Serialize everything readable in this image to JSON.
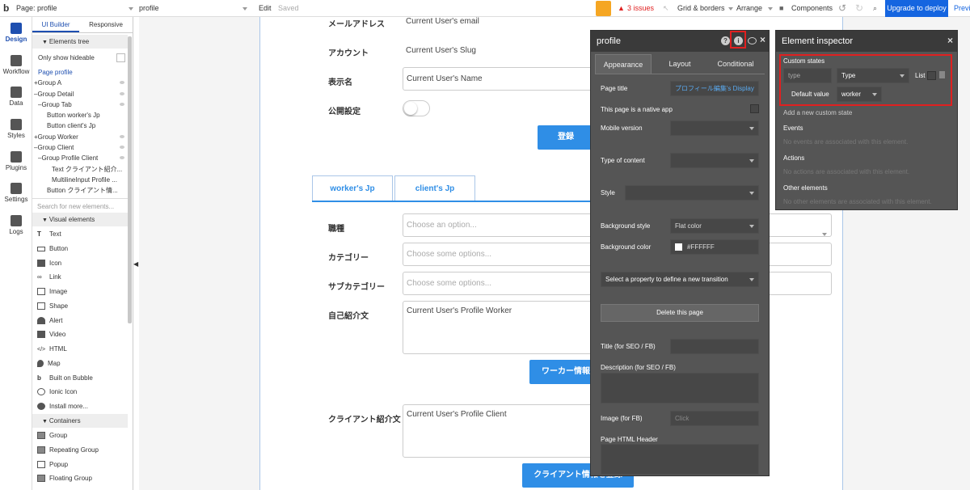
{
  "topbar": {
    "page_label": "Page: profile",
    "page_select": "profile",
    "edit": "Edit",
    "saved": "Saved",
    "issues": "3 issues",
    "grid": "Grid & borders",
    "arrange": "Arrange",
    "components": "Components",
    "upgrade": "Upgrade to deploy",
    "preview": "Previ"
  },
  "rail": [
    {
      "label": "Design",
      "icon": "design-icon"
    },
    {
      "label": "Workflow",
      "icon": "workflow-icon"
    },
    {
      "label": "Data",
      "icon": "data-icon"
    },
    {
      "label": "Styles",
      "icon": "styles-icon"
    },
    {
      "label": "Plugins",
      "icon": "plugins-icon"
    },
    {
      "label": "Settings",
      "icon": "settings-icon"
    },
    {
      "label": "Logs",
      "icon": "logs-icon"
    }
  ],
  "palette": {
    "tab_ui": "UI Builder",
    "tab_responsive": "Responsive",
    "elements_tree": "Elements tree",
    "only_hideable": "Only show hideable",
    "tree": [
      "Page profile",
      "Group A",
      "Group Detail",
      "Group Tab",
      "Button worker's Jp",
      "Button client's Jp",
      "Group Worker",
      "Group Client",
      "Group Profile Client",
      "Text クライアント紹介...",
      "MultilineInput Profile ...",
      "Button クライアント情..."
    ],
    "search_placeholder": "Search for new elements...",
    "visual_elements": "Visual elements",
    "visual": [
      "Text",
      "Button",
      "Icon",
      "Link",
      "Image",
      "Shape",
      "Alert",
      "Video",
      "HTML",
      "Map",
      "Built on Bubble",
      "Ionic Icon",
      "Install more..."
    ],
    "containers": "Containers",
    "container_items": [
      "Group",
      "Repeating Group",
      "Popup",
      "Floating Group"
    ]
  },
  "page": {
    "email_label": "メールアドレス",
    "email_value": "Current User's email",
    "account_label": "アカウント",
    "account_value": "Current User's Slug",
    "display_label": "表示名",
    "display_value": "Current User's Name",
    "public_label": "公開設定",
    "register_btn": "登録",
    "tab_worker": "worker's Jp",
    "tab_client": "client's Jp",
    "job_label": "職種",
    "job_placeholder": "Choose an option...",
    "category_label": "カテゴリー",
    "category_placeholder": "Choose some options...",
    "subcategory_label": "サブカテゴリー",
    "subcategory_placeholder": "Choose some options...",
    "intro_label": "自己紹介文",
    "intro_value": "Current User's Profile Worker",
    "worker_btn": "ワーカー情報",
    "client_label": "クライアント紹介文",
    "client_value": "Current User's Profile Client",
    "client_btn": "クライアント情報を登録"
  },
  "prop": {
    "title": "profile",
    "tab_appearance": "Appearance",
    "tab_layout": "Layout",
    "tab_conditional": "Conditional",
    "page_title_label": "Page title",
    "page_title_value": "プロフィール編集's Display",
    "native_app": "This page is a native app",
    "mobile_version": "Mobile version",
    "type_content": "Type of content",
    "style": "Style",
    "bg_style": "Background style",
    "bg_style_value": "Flat color",
    "bg_color": "Background color",
    "bg_color_value": "#FFFFFF",
    "transition": "Select a property to define a new transition",
    "delete": "Delete this page",
    "seo_title": "Title (for SEO / FB)",
    "seo_desc": "Description (for SEO / FB)",
    "image_fb": "Image (for FB)",
    "image_click": "Click",
    "html_header": "Page HTML Header"
  },
  "inspector": {
    "title": "Element inspector",
    "custom_states": "Custom states",
    "state_name": "type",
    "state_type": "Type",
    "list": "List",
    "default_value_label": "Default value",
    "default_value": "worker",
    "add_state": "Add a new custom state",
    "events": "Events",
    "events_desc": "No events are associated with this element.",
    "actions": "Actions",
    "actions_desc": "No actions are associated with this element.",
    "other": "Other elements",
    "other_desc": "No other elements are associated with this element."
  },
  "colors": {
    "accent": "#2f8ee6",
    "highlight": "#e02020",
    "warning": "#f5a623"
  }
}
